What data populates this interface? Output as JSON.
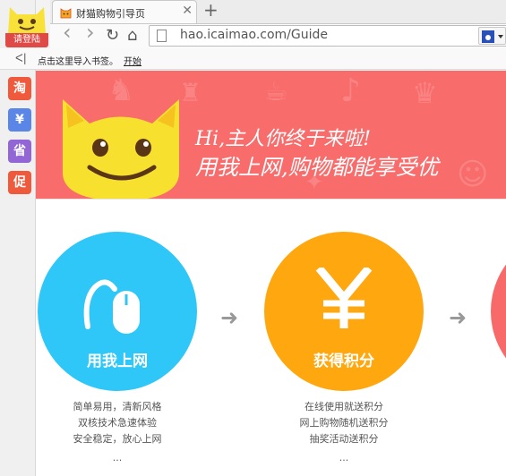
{
  "sidebar": {
    "login_label": "请登陆",
    "buttons": [
      {
        "label": "淘",
        "color": "#ef5a3c"
      },
      {
        "label": "¥",
        "color": "#5a86e8"
      },
      {
        "label": "省",
        "color": "#9366d6"
      },
      {
        "label": "促",
        "color": "#ef5a3c"
      }
    ]
  },
  "browser": {
    "tab_title": "财猫购物引导页",
    "tab_close": "✕",
    "new_tab": "+",
    "back": "‹",
    "forward": "›",
    "reload": "↻",
    "home": "⌂",
    "address": "hao.icaimao.com/Guide",
    "star": "☆"
  },
  "bookmarks": {
    "back_glyph": "ᐸ|",
    "prompt": "点击这里导入书签。",
    "start_link": "开始"
  },
  "banner": {
    "line1": "Hi,主人你终于来啦!",
    "line2": "用我上网,购物都能享受优"
  },
  "steps": [
    {
      "title": "用我上网",
      "color": "#2ec7f8",
      "icon": "mouse-icon",
      "lines": [
        "简单易用，清新风格",
        "双核技术急速体验",
        "安全稳定，放心上网"
      ],
      "more": "..."
    },
    {
      "title": "获得积分",
      "color": "#ffa70f",
      "icon": "yen-icon",
      "lines": [
        "在线使用就送积分",
        "网上购物随机送积分",
        "抽奖活动送积分"
      ],
      "more": "..."
    },
    {
      "title": "",
      "color": "#f86a6a",
      "icon": "",
      "lines": [],
      "more": ""
    }
  ],
  "arrow_glyph": "➜"
}
